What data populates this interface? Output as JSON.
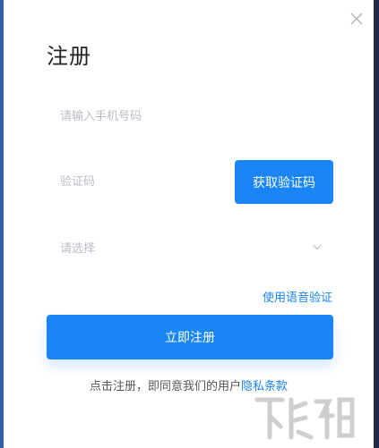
{
  "dialog": {
    "title": "注册",
    "close_icon": "close-icon"
  },
  "form": {
    "phone_placeholder": "请输入手机号码",
    "code_placeholder": "验证码",
    "get_code_label": "获取验证码",
    "region_select_value": "请选择",
    "chevron_icon": "chevron-down-icon",
    "voice_verify_label": "使用语音验证",
    "register_label": "立即注册"
  },
  "agreement": {
    "prefix": "点击注册，即同意我们的用户",
    "link": "隐私条款"
  },
  "colors": {
    "accent": "#1a86f5",
    "title": "#222222",
    "placeholder": "#b8bcc4"
  }
}
